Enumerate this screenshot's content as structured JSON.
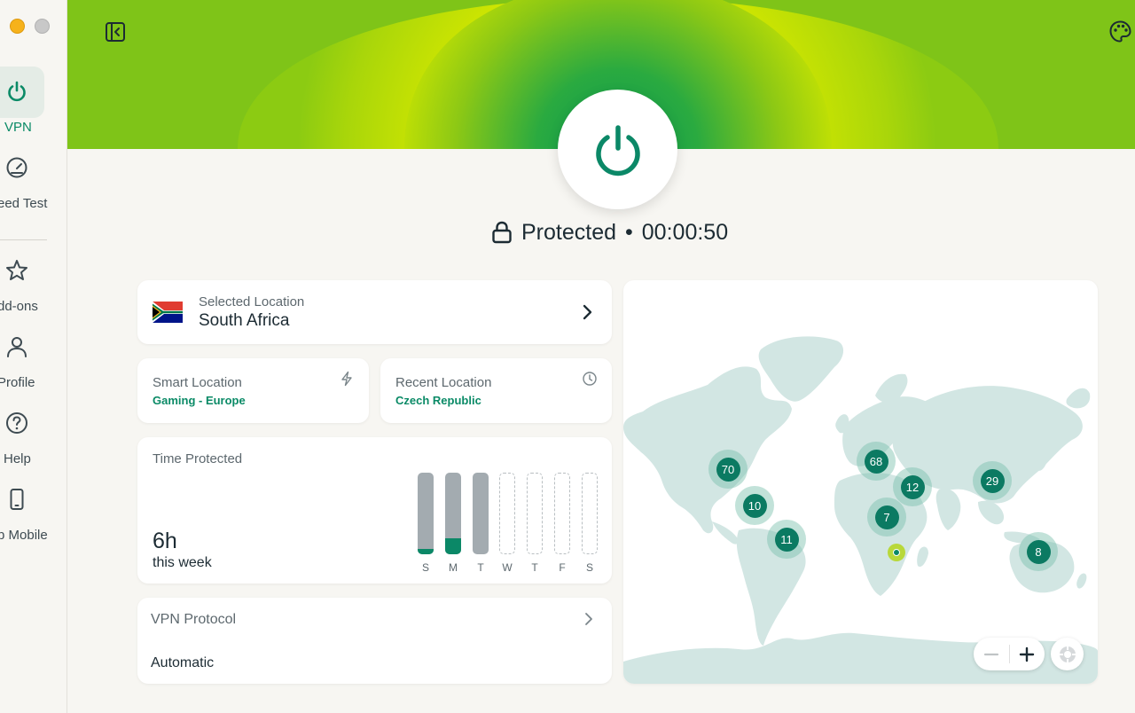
{
  "sidebar": {
    "items": [
      {
        "label": "VPN",
        "icon": "power-icon",
        "active": true
      },
      {
        "label": "eed Test",
        "icon": "speedometer-icon",
        "active": false
      },
      {
        "label": "dd-ons",
        "icon": "star-icon",
        "active": false
      },
      {
        "label": "Profile",
        "icon": "person-icon",
        "active": false
      },
      {
        "label": "Help",
        "icon": "help-circle-icon",
        "active": false
      },
      {
        "label": "p Mobile",
        "icon": "smartphone-icon",
        "active": false
      }
    ]
  },
  "status": {
    "text": "Protected",
    "separator": "•",
    "timer": "00:00:50"
  },
  "selected_location": {
    "label": "Selected Location",
    "value": "South Africa",
    "flag": "south-africa-flag"
  },
  "smart_location": {
    "label": "Smart Location",
    "value": "Gaming - Europe",
    "icon": "lightning-icon"
  },
  "recent_location": {
    "label": "Recent Location",
    "value": "Czech Republic",
    "icon": "clock-icon"
  },
  "time_protected": {
    "label": "Time Protected",
    "hours": "6h",
    "period": "this week",
    "days": [
      {
        "day": "S",
        "active": true,
        "fill": 0.07
      },
      {
        "day": "M",
        "active": true,
        "fill": 0.2
      },
      {
        "day": "T",
        "active": true,
        "fill": 0.0
      },
      {
        "day": "W",
        "active": false,
        "fill": 0.0
      },
      {
        "day": "T",
        "active": false,
        "fill": 0.0
      },
      {
        "day": "F",
        "active": false,
        "fill": 0.0
      },
      {
        "day": "S",
        "active": false,
        "fill": 0.0
      }
    ]
  },
  "protocol": {
    "label": "VPN Protocol",
    "value": "Automatic"
  },
  "map": {
    "clusters": [
      "70",
      "10",
      "11",
      "68",
      "12",
      "7",
      "29",
      "8"
    ]
  },
  "colors": {
    "accent": "#0a8a66",
    "header_green": "#7cc218",
    "header_lime": "#cde600",
    "background": "#f7f6f2"
  }
}
